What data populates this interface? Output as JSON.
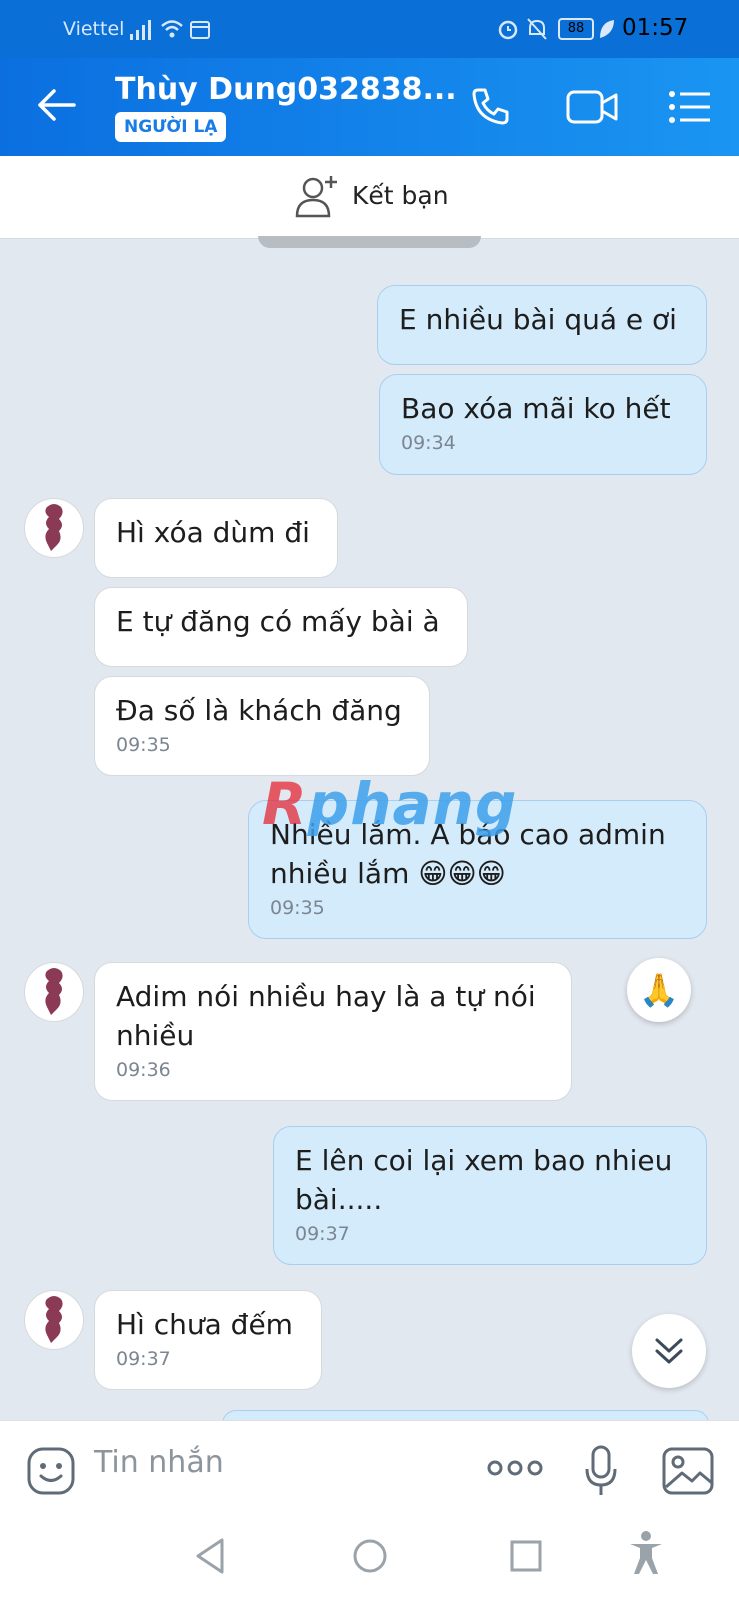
{
  "status_bar": {
    "carrier": "Viettel",
    "battery": "88",
    "time": "01:57"
  },
  "header": {
    "title": "Thùy Dung032838...",
    "badge": "NGƯỜI LẠ"
  },
  "friend_bar": {
    "label": "Kết bạn"
  },
  "watermark": {
    "part1": "R",
    "part2": "phang"
  },
  "messages": [
    {
      "dir": "out",
      "text": "E nhiều bài quá e ơi"
    },
    {
      "dir": "out",
      "text": "Bao xóa mãi ko hết",
      "time": "09:34"
    },
    {
      "dir": "in",
      "text": "Hì xóa dùm đi"
    },
    {
      "dir": "in",
      "text": "E tự đăng có mấy bài à"
    },
    {
      "dir": "in",
      "text": "Đa số là khách đăng",
      "time": "09:35"
    },
    {
      "dir": "out",
      "text": "Nhiều lắm. A báo cao admin nhiều lắm 😁😁😁",
      "line1": "Nhiều lắm. A báo cao admin",
      "line2": "nhiều lắm 😁😁😁",
      "time": "09:35"
    },
    {
      "dir": "in",
      "text": "Adim nói nhiều hay là a tự nói nhiều",
      "line1": "Adim nói nhiều hay là a tự nói",
      "line2": "nhiều",
      "time": "09:36"
    },
    {
      "dir": "out",
      "text": "E lên coi lại xem bao nhieu bài.....",
      "line1": "E lên coi lại xem bao nhieu",
      "line2": "bài.....",
      "time": "09:37"
    },
    {
      "dir": "in",
      "text": "Hì chưa đếm",
      "time": "09:37"
    }
  ],
  "reaction": {
    "emoji": "🙏"
  },
  "input": {
    "placeholder": "Tin nhắn"
  },
  "icons": [
    "back-arrow-icon",
    "phone-icon",
    "video-icon",
    "list-icon",
    "add-friend-icon",
    "emoji-icon",
    "more-icon",
    "mic-icon",
    "image-icon",
    "scroll-down-icon",
    "nav-back-icon",
    "nav-home-icon",
    "nav-recent-icon",
    "accessibility-icon"
  ],
  "colors": {
    "header": "#0b6fe0",
    "outgoing_bubble": "#d4ebfb",
    "incoming_bubble": "#ffffff",
    "background": "#e2e8ef"
  }
}
